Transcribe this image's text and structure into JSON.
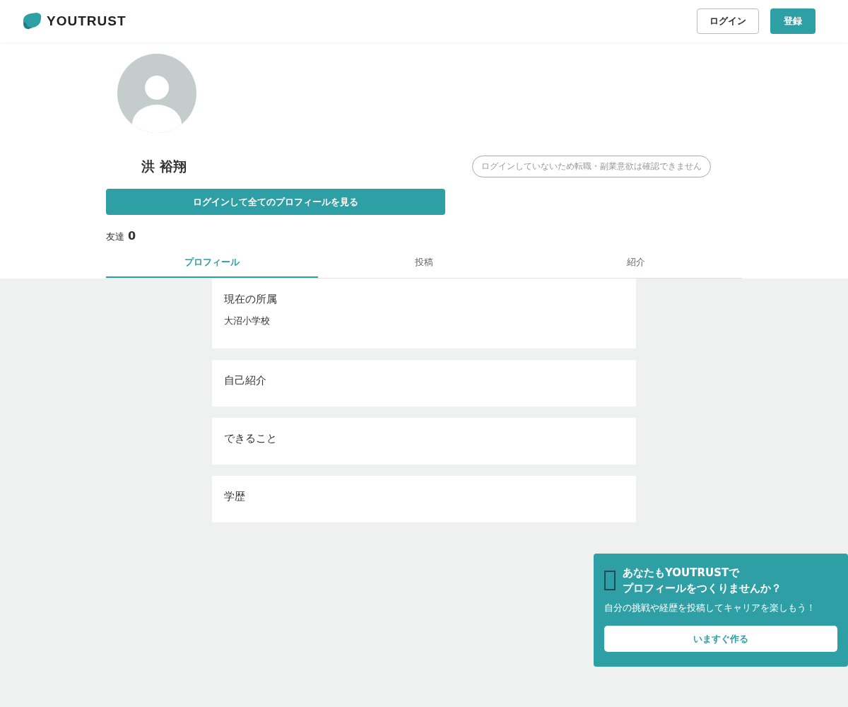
{
  "header": {
    "logo": "YOUTRUST",
    "login_button": "ログイン",
    "signup_button": "登録"
  },
  "profile": {
    "name": "洪 裕翔",
    "notice": "ログインしていないため転職・副業意欲は確認できません",
    "view_button": "ログインして全てのプロフィールを見る",
    "friends_label": "友達",
    "friends_count": "0"
  },
  "tabs": [
    {
      "label": "プロフィール",
      "selected": true
    },
    {
      "label": "投稿",
      "selected": false
    },
    {
      "label": "紹介",
      "selected": false
    }
  ],
  "sections": [
    {
      "title": "現在の所属",
      "value": "大沼小学校"
    },
    {
      "title": "自己紹介"
    },
    {
      "title": "できること"
    },
    {
      "title": "学歴"
    }
  ],
  "banner": {
    "title_line1": "あなたもYOUTRUSTで",
    "title_line2": "プロフィールをつくりませんか？",
    "subtitle": "自分の挑戦や経歴を投稿してキャリアを楽しもう！",
    "button": "いますぐ作る"
  }
}
